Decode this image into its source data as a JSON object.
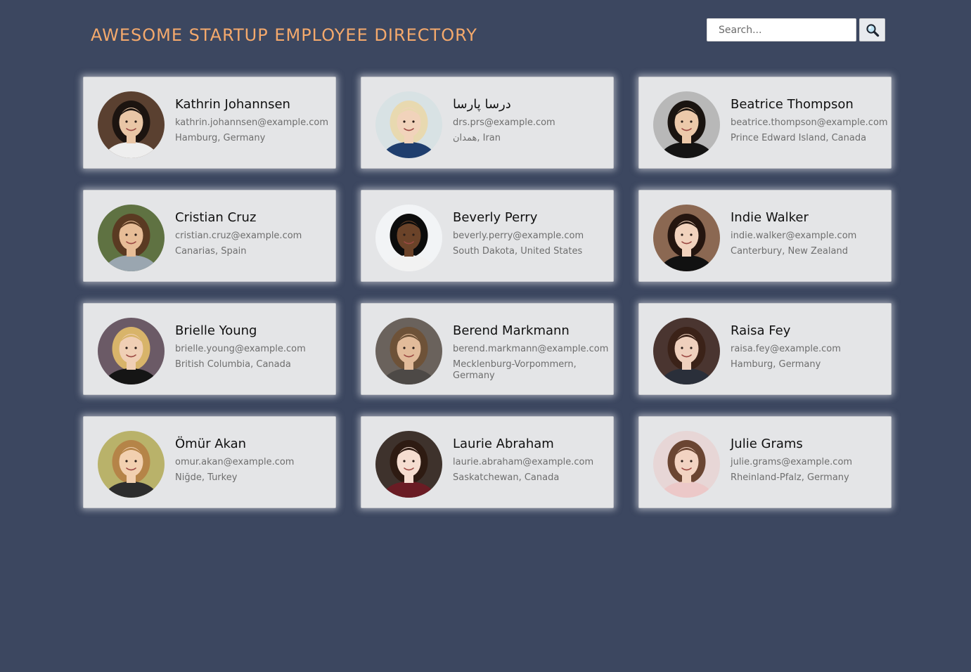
{
  "header": {
    "title": "AWESOME STARTUP EMPLOYEE DIRECTORY"
  },
  "search": {
    "placeholder": "Search...",
    "button_icon": "magnifier-icon"
  },
  "colors": {
    "background": "#3c4760",
    "title": "#f4a96c",
    "card": "#e4e5e7"
  },
  "employees": [
    {
      "name": "Kathrin Johannsen",
      "email": "kathrin.johannsen@example.com",
      "location": "Hamburg, Germany"
    },
    {
      "name": "درسا پارسا",
      "email": "drs.prs@example.com",
      "location": "همدان, Iran"
    },
    {
      "name": "Beatrice Thompson",
      "email": "beatrice.thompson@example.com",
      "location": "Prince Edward Island, Canada"
    },
    {
      "name": "Cristian Cruz",
      "email": "cristian.cruz@example.com",
      "location": "Canarias, Spain"
    },
    {
      "name": "Beverly Perry",
      "email": "beverly.perry@example.com",
      "location": "South Dakota, United States"
    },
    {
      "name": "Indie Walker",
      "email": "indie.walker@example.com",
      "location": "Canterbury, New Zealand"
    },
    {
      "name": "Brielle Young",
      "email": "brielle.young@example.com",
      "location": "British Columbia, Canada"
    },
    {
      "name": "Berend Markmann",
      "email": "berend.markmann@example.com",
      "location": "Mecklenburg-Vorpommern, Germany"
    },
    {
      "name": "Raisa Fey",
      "email": "raisa.fey@example.com",
      "location": "Hamburg, Germany"
    },
    {
      "name": "Ömür Akan",
      "email": "omur.akan@example.com",
      "location": "Niğde, Turkey"
    },
    {
      "name": "Laurie Abraham",
      "email": "laurie.abraham@example.com",
      "location": "Saskatchewan, Canada"
    },
    {
      "name": "Julie Grams",
      "email": "julie.grams@example.com",
      "location": "Rheinland-Pfalz, Germany"
    }
  ]
}
